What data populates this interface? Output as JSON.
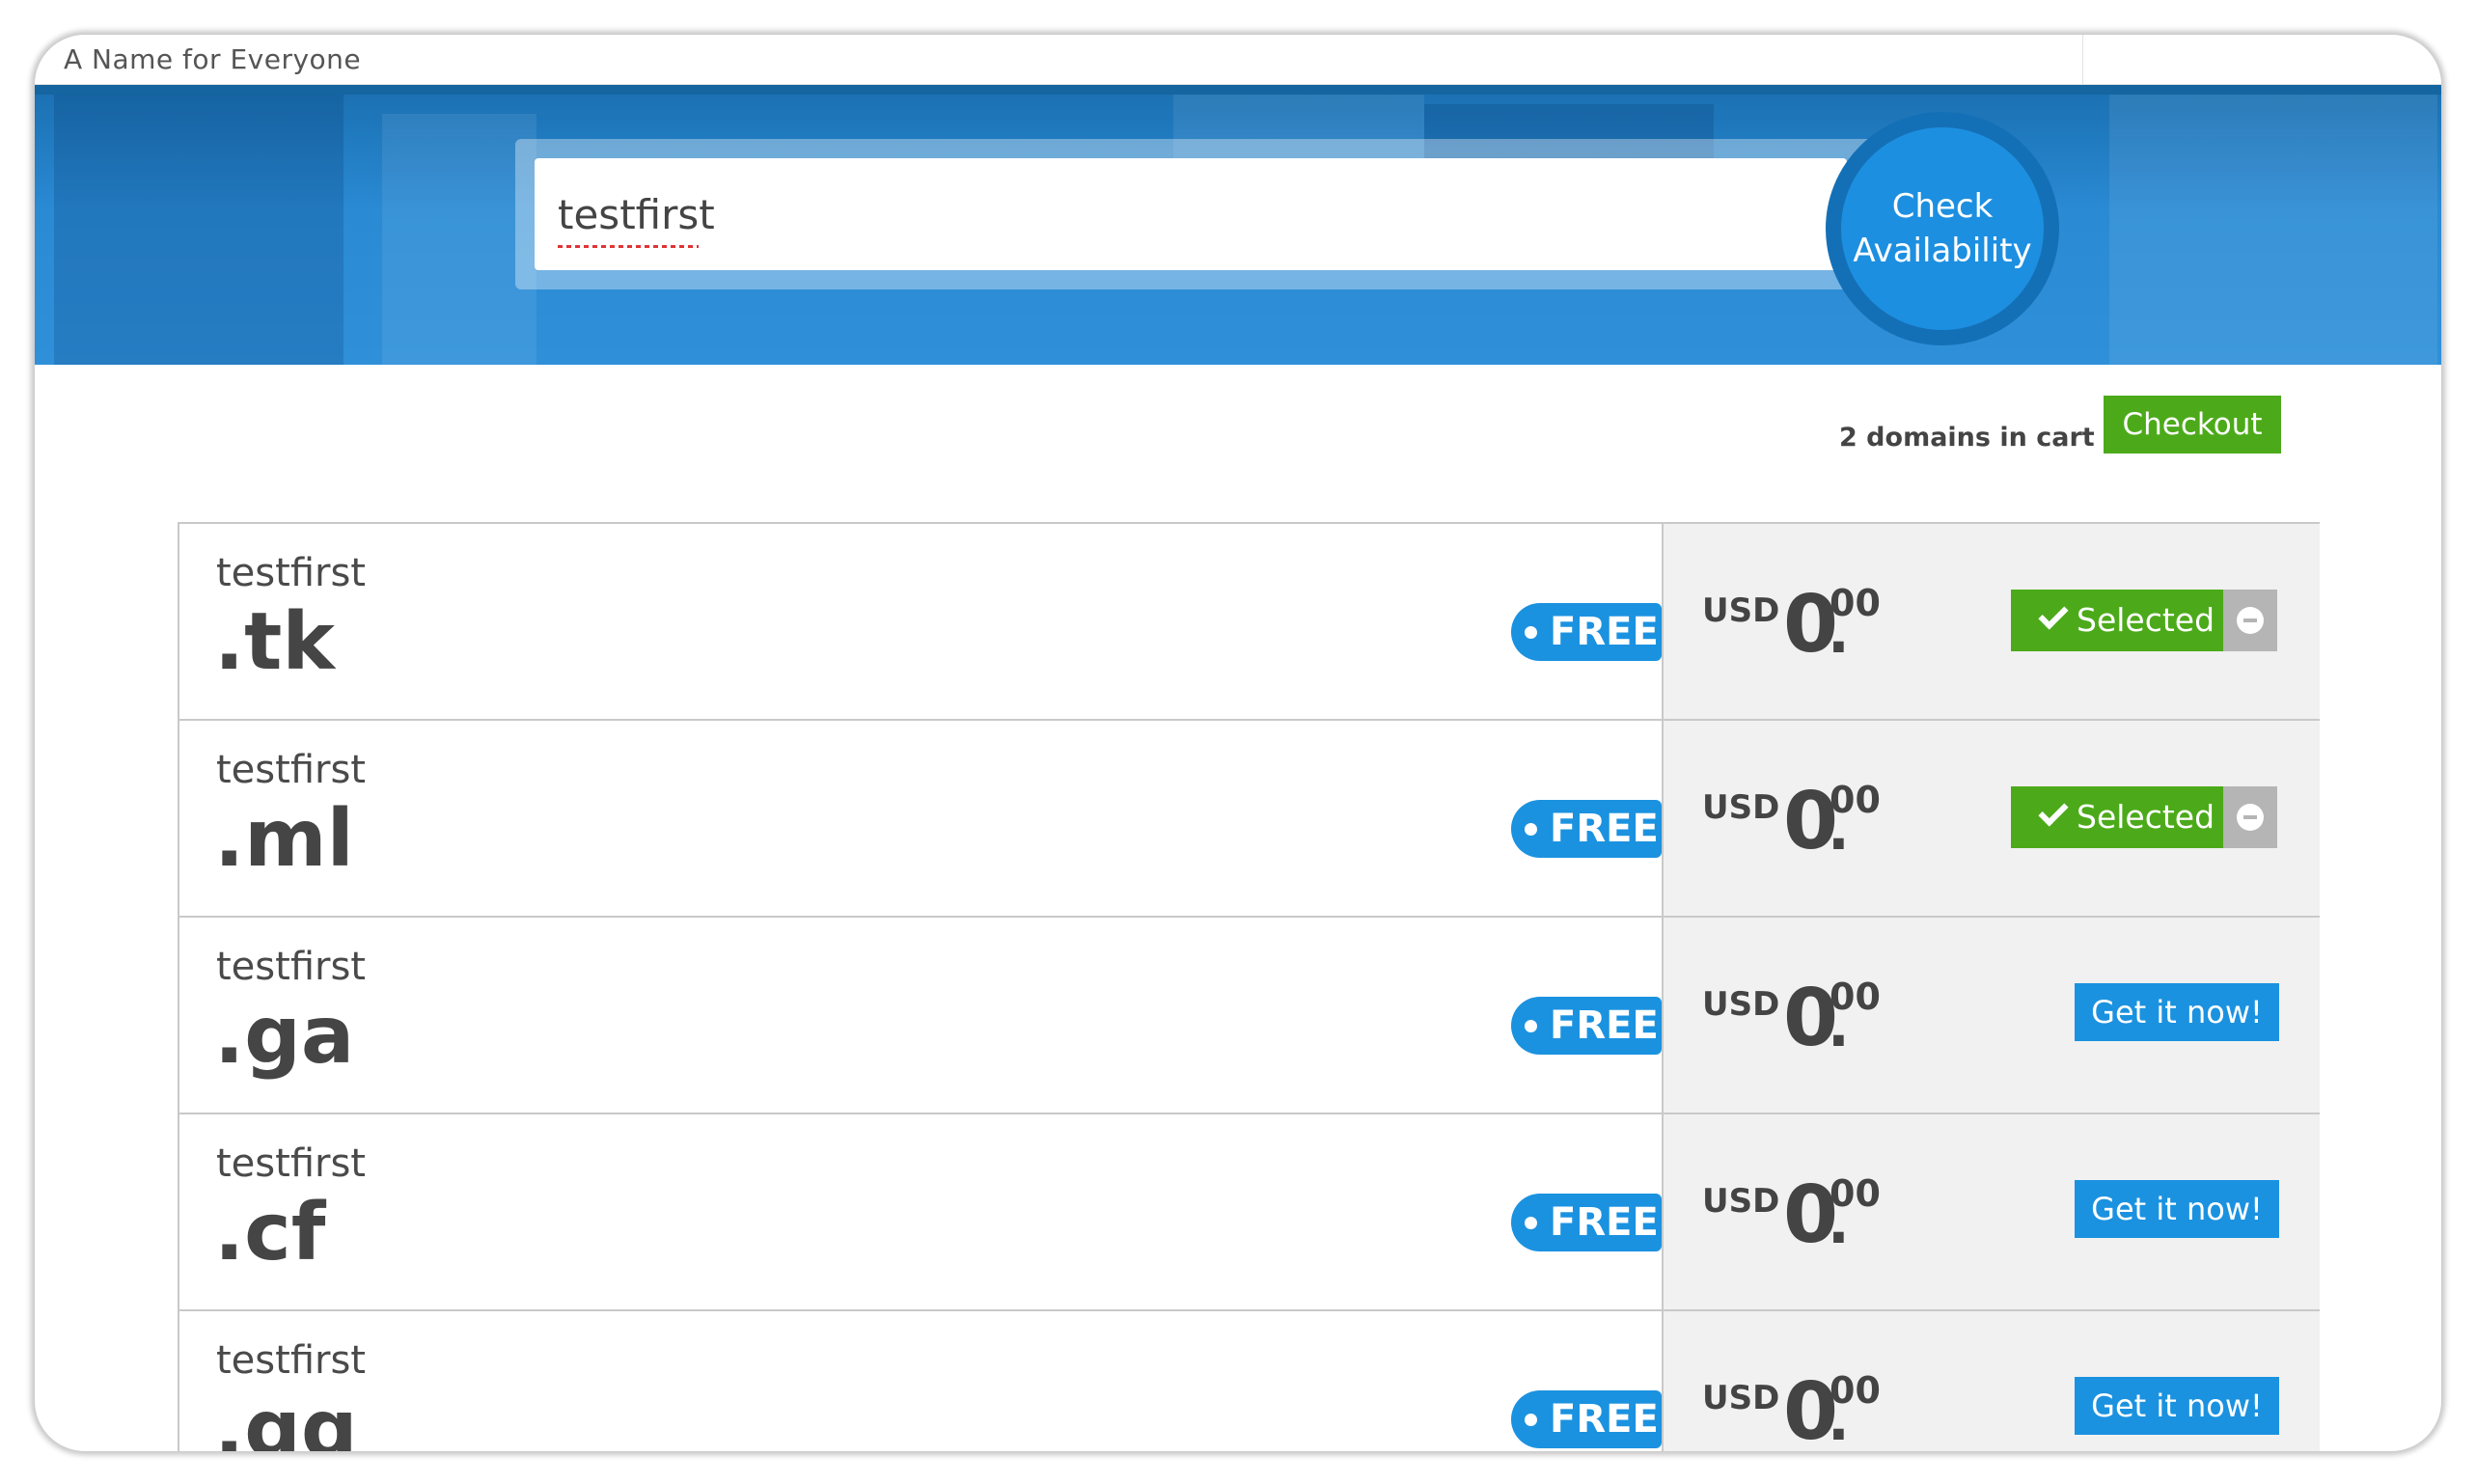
{
  "header": {
    "tagline": "A Name for Everyone"
  },
  "search": {
    "value": "testfirst",
    "button_label": "Check Availability"
  },
  "cart": {
    "info": "2 domains in cart",
    "checkout_label": "Checkout"
  },
  "results": [
    {
      "name": "testfirst",
      "tld": ".tk",
      "tag": "FREE",
      "currency": "USD",
      "price_int": "0",
      "price_sep": ".",
      "price_dec": "00",
      "status": "selected",
      "action_label": "Selected"
    },
    {
      "name": "testfirst",
      "tld": ".ml",
      "tag": "FREE",
      "currency": "USD",
      "price_int": "0",
      "price_sep": ".",
      "price_dec": "00",
      "status": "selected",
      "action_label": "Selected"
    },
    {
      "name": "testfirst",
      "tld": ".ga",
      "tag": "FREE",
      "currency": "USD",
      "price_int": "0",
      "price_sep": ".",
      "price_dec": "00",
      "status": "available",
      "action_label": "Get it now!"
    },
    {
      "name": "testfirst",
      "tld": ".cf",
      "tag": "FREE",
      "currency": "USD",
      "price_int": "0",
      "price_sep": ".",
      "price_dec": "00",
      "status": "available",
      "action_label": "Get it now!"
    },
    {
      "name": "testfirst",
      "tld": ".gq",
      "tag": "FREE",
      "currency": "USD",
      "price_int": "0",
      "price_sep": ".",
      "price_dec": "00",
      "status": "available",
      "action_label": "Get it now!"
    }
  ],
  "colors": {
    "brand_blue": "#1b92e0",
    "hero_blue": "#2a8ad4",
    "selected_green": "#4caa1a",
    "remove_gray": "#b5b5b5"
  },
  "icons": {
    "selected": "check-icon",
    "remove": "minus-circle-icon",
    "tag": "tag-dot-icon"
  }
}
